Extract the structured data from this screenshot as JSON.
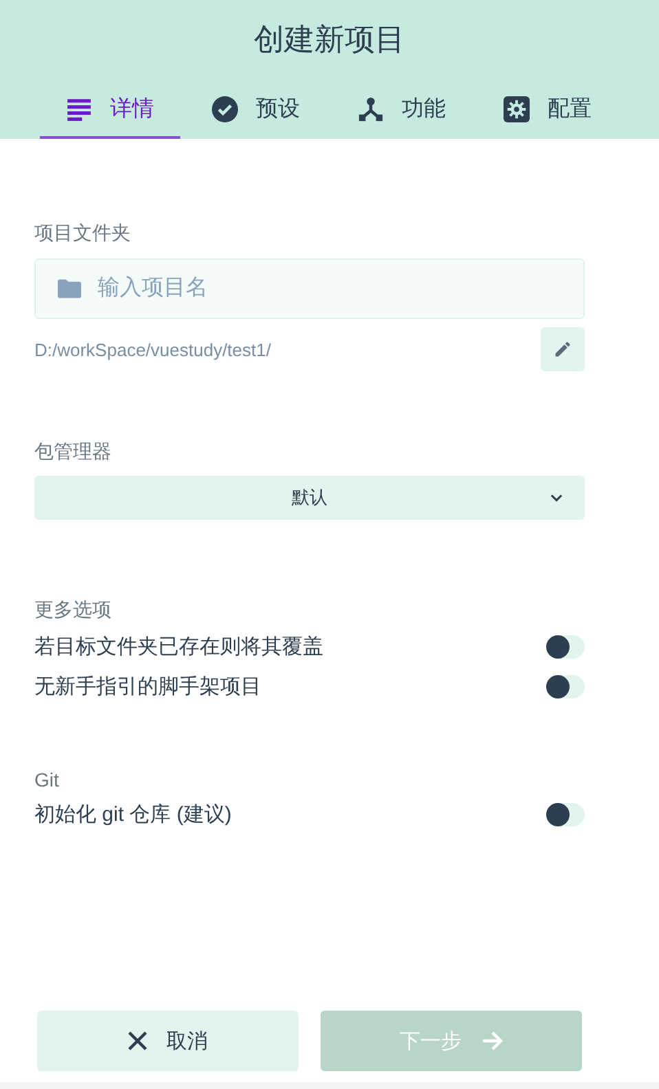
{
  "title": "创建新项目",
  "tabs": [
    {
      "label": "详情",
      "selected": true
    },
    {
      "label": "预设",
      "selected": false
    },
    {
      "label": "功能",
      "selected": false
    },
    {
      "label": "配置",
      "selected": false
    }
  ],
  "folder": {
    "label": "项目文件夹",
    "placeholder": "输入项目名",
    "path": "D:/workSpace/vuestudy/test1/"
  },
  "package_manager": {
    "label": "包管理器",
    "value": "默认"
  },
  "more_options": {
    "label": "更多选项",
    "toggles": [
      {
        "label": "若目标文件夹已存在则将其覆盖",
        "on": false
      },
      {
        "label": "无新手指引的脚手架项目",
        "on": false
      }
    ]
  },
  "git": {
    "label": "Git",
    "toggles": [
      {
        "label": "初始化 git 仓库 (建议)",
        "on": false
      }
    ]
  },
  "buttons": [
    {
      "label": "取消",
      "kind": "cancel",
      "disabled": false
    },
    {
      "label": "下一步",
      "kind": "next",
      "disabled": true
    }
  ]
}
